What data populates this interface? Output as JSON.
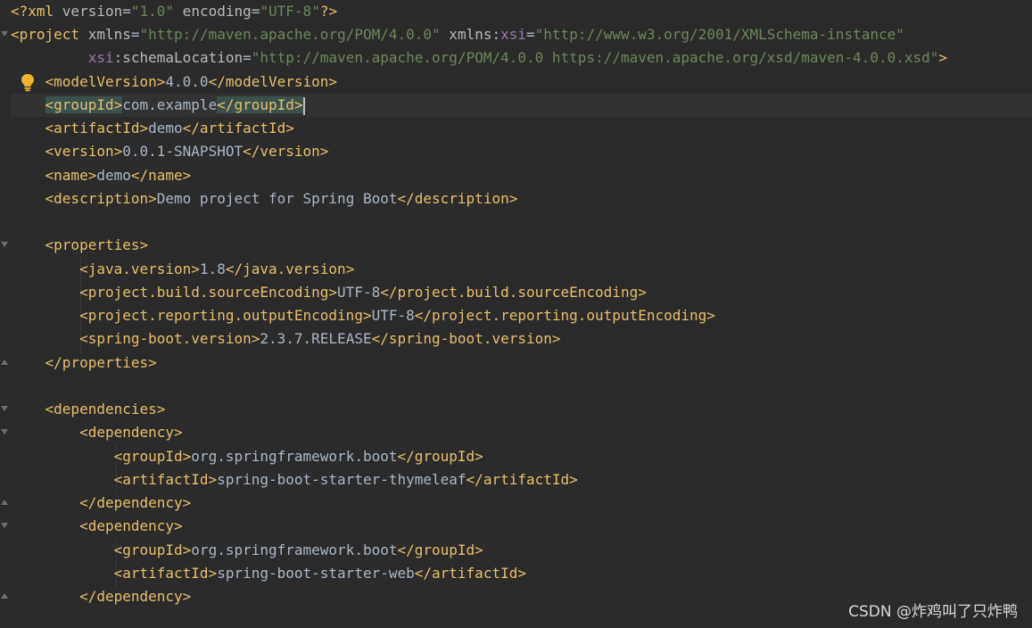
{
  "prolog": {
    "open": "<?xml ",
    "version_attr": "version",
    "eq": "=",
    "version_val": "\"1.0\"",
    "encoding_attr": " encoding",
    "encoding_val": "\"UTF-8\"",
    "close": "?>"
  },
  "project": {
    "open": "<project ",
    "xmlns_attr": "xmlns",
    "xmlns_val": "\"http://maven.apache.org/POM/4.0.0\"",
    "xmlns_prefix": " xmlns",
    "colon": ":",
    "xsi": "xsi",
    "xsi_val": "\"http://www.w3.org/2001/XMLSchema-instance\"",
    "schema_prefix": "xsi",
    "schema_attr": "schemaLocation",
    "schema_val": "\"http://maven.apache.org/POM/4.0.0 https://maven.apache.org/xsd/maven-4.0.0.xsd\"",
    "close": ">"
  },
  "elements": {
    "modelVersion": {
      "open": "<modelVersion>",
      "value": "4.0.0",
      "close": "</modelVersion>"
    },
    "groupId": {
      "open": "<groupId>",
      "value": "com.example",
      "close": "</groupId>"
    },
    "artifactId": {
      "open": "<artifactId>",
      "value": "demo",
      "close": "</artifactId>"
    },
    "version": {
      "open": "<version>",
      "value": "0.0.1-SNAPSHOT",
      "close": "</version>"
    },
    "name": {
      "open": "<name>",
      "value": "demo",
      "close": "</name>"
    },
    "description": {
      "open": "<description>",
      "value": "Demo project for Spring Boot",
      "close": "</description>"
    }
  },
  "properties": {
    "open": "<properties>",
    "close": "</properties>",
    "java_version": {
      "open": "<java.version>",
      "value": "1.8",
      "close": "</java.version>"
    },
    "source_encoding": {
      "open": "<project.build.sourceEncoding>",
      "value": "UTF-8",
      "close": "</project.build.sourceEncoding>"
    },
    "output_encoding": {
      "open": "<project.reporting.outputEncoding>",
      "value": "UTF-8",
      "close": "</project.reporting.outputEncoding>"
    },
    "spring_boot_version": {
      "open": "<spring-boot.version>",
      "value": "2.3.7.RELEASE",
      "close": "</spring-boot.version>"
    }
  },
  "dependencies": {
    "open": "<dependencies>",
    "dep_open": "<dependency>",
    "dep_close": "</dependency>",
    "items": [
      {
        "group_open": "<groupId>",
        "group": "org.springframework.boot",
        "group_close": "</groupId>",
        "artifact_open": "<artifactId>",
        "artifact": "spring-boot-starter-thymeleaf",
        "artifact_close": "</artifactId>"
      },
      {
        "group_open": "<groupId>",
        "group": "org.springframework.boot",
        "group_close": "</groupId>",
        "artifact_open": "<artifactId>",
        "artifact": "spring-boot-starter-web",
        "artifact_close": "</artifactId>"
      }
    ]
  },
  "watermark": "CSDN @炸鸡叫了只炸鸭",
  "icons": {
    "intention": "lightbulb-icon",
    "fold": "fold-marker-icon"
  },
  "colors": {
    "background": "#2b2b2b",
    "tag": "#e8bf6a",
    "string": "#6a8759",
    "namespace": "#9876aa",
    "text": "#a9b7c6",
    "match_highlight": "#3b514d"
  }
}
